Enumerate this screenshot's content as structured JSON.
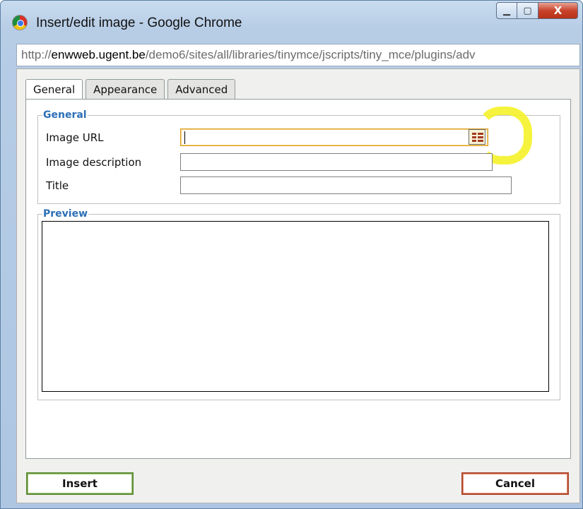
{
  "window": {
    "title": "Insert/edit image - Google Chrome",
    "minimize_glyph": "▁",
    "maximize_glyph": "▢",
    "close_glyph": "X"
  },
  "address": {
    "prefix": "http://",
    "host": "enwweb.ugent.be",
    "path": "/demo6/sites/all/libraries/tinymce/jscripts/tiny_mce/plugins/adv"
  },
  "tabs": [
    {
      "label": "General",
      "active": true
    },
    {
      "label": "Appearance",
      "active": false
    },
    {
      "label": "Advanced",
      "active": false
    }
  ],
  "general": {
    "legend": "General",
    "image_url_label": "Image URL",
    "image_url_value": "",
    "image_description_label": "Image description",
    "image_description_value": "",
    "title_label": "Title",
    "title_value": ""
  },
  "preview": {
    "legend": "Preview"
  },
  "buttons": {
    "insert": "Insert",
    "cancel": "Cancel"
  },
  "colors": {
    "legend": "#2b6fb6",
    "insert_border": "#5f8f3a",
    "cancel_border": "#b14b2f",
    "highlight": "#f6f22a",
    "focus_border": "#d89a1e"
  },
  "icons": {
    "browse": "browse-file-icon",
    "app": "chrome-logo-icon"
  }
}
